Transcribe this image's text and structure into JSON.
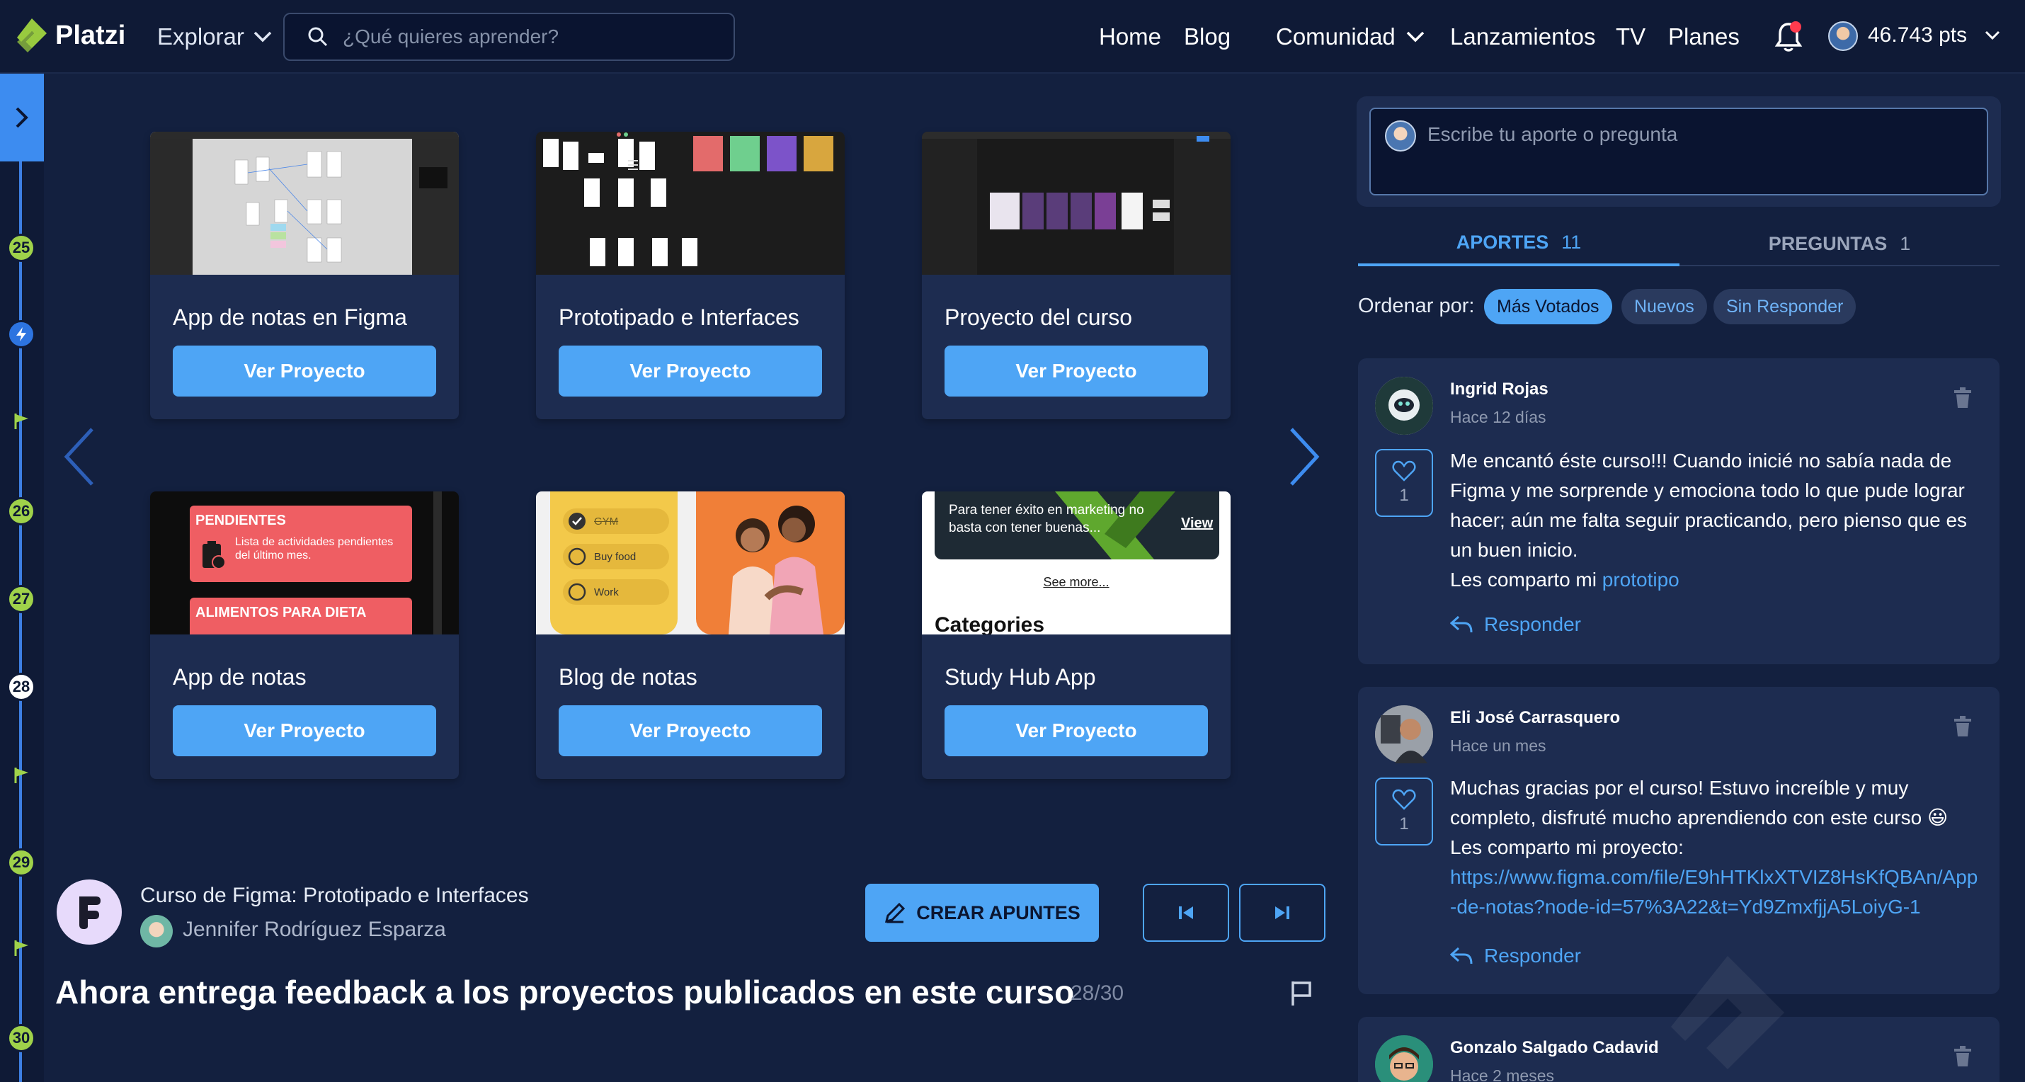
{
  "nav": {
    "logo_text": "Platzi",
    "explore_label": "Explorar",
    "search_placeholder": "¿Qué quieres aprender?",
    "links": [
      "Home",
      "Blog",
      "Comunidad",
      "Lanzamientos",
      "TV",
      "Planes"
    ],
    "points": "46.743 pts"
  },
  "timeline": {
    "nodes": [
      "25",
      "26",
      "27",
      "28",
      "29",
      "30"
    ],
    "current": "28"
  },
  "projects": [
    {
      "title": "App de notas en Figma",
      "button": "Ver Proyecto"
    },
    {
      "title": "Prototipado e Interfaces",
      "button": "Ver Proyecto"
    },
    {
      "title": "Proyecto del curso",
      "button": "Ver Proyecto"
    },
    {
      "title": "App de notas",
      "button": "Ver Proyecto"
    },
    {
      "title": "Blog de notas",
      "button": "Ver Proyecto"
    },
    {
      "title": "Study Hub App",
      "button": "Ver Proyecto"
    }
  ],
  "thumbs": {
    "p4_line1": "PENDIENTES",
    "p4_line2": "Lista de actividades pendientes del último mes.",
    "p4_line3": "ALIMENTOS PARA DIETA",
    "p5_items": [
      "GYM",
      "Buy food",
      "Work"
    ],
    "p6_line1": "Para tener éxito en marketing no basta con tener buenas...",
    "p6_view": "View",
    "p6_see_more": "See more...",
    "p6_categories": "Categories"
  },
  "course": {
    "name": "Curso de Figma: Prototipado e Interfaces",
    "teacher": "Jennifer Rodríguez Esparza",
    "crear_apuntes": "CREAR APUNTES",
    "class_title": "Ahora entrega feedback a los proyectos publicados en este curso",
    "class_count": "28/30"
  },
  "panel": {
    "composer_placeholder": "Escribe tu aporte o pregunta",
    "tabs": [
      {
        "label": "APORTES",
        "count": "11"
      },
      {
        "label": "PREGUNTAS",
        "count": "1"
      }
    ],
    "order_label": "Ordenar por:",
    "chips": [
      "Más Votados",
      "Nuevos",
      "Sin Responder"
    ]
  },
  "comments": [
    {
      "name": "Ingrid Rojas",
      "time": "Hace 12 días",
      "likes": "1",
      "body": "Me encantó éste curso!!! Cuando inicié no sabía nada de Figma y me sorprende y emociona todo lo que pude lograr hacer; aún me falta seguir practicando, pero pienso que es un buen inicio.",
      "body2": "Les comparto mi ",
      "link": "prototipo",
      "reply": "Responder"
    },
    {
      "name": "Eli José Carrasquero",
      "time": "Hace un mes",
      "likes": "1",
      "body": "Muchas gracias por el curso! Estuvo increíble y muy completo, disfruté mucho aprendiendo con este curso 😃",
      "body2": "Les comparto mi proyecto:",
      "link": "https://www.figma.com/file/E9hHTKlxXTVIZ8HsKfQBAn/App-de-notas?node-id=57%3A22&t=Yd9ZmxfjjA5LoiyG-1",
      "reply": "Responder"
    },
    {
      "name": "Gonzalo Salgado Cadavid",
      "time": "Hace 2 meses"
    }
  ],
  "colors": {
    "bg": "#13203f",
    "accent": "#4ea5f5",
    "timeline_green": "#9fd24a",
    "logo_green": "#98ca3f"
  },
  "icons": [
    "platzi-logo-icon",
    "search-icon",
    "chevron-down-icon",
    "bell-icon",
    "chevron-right-icon",
    "flag-icon",
    "bolt-icon",
    "pencil-icon",
    "skip-back-icon",
    "skip-forward-icon",
    "trash-icon",
    "heart-icon",
    "reply-icon"
  ]
}
